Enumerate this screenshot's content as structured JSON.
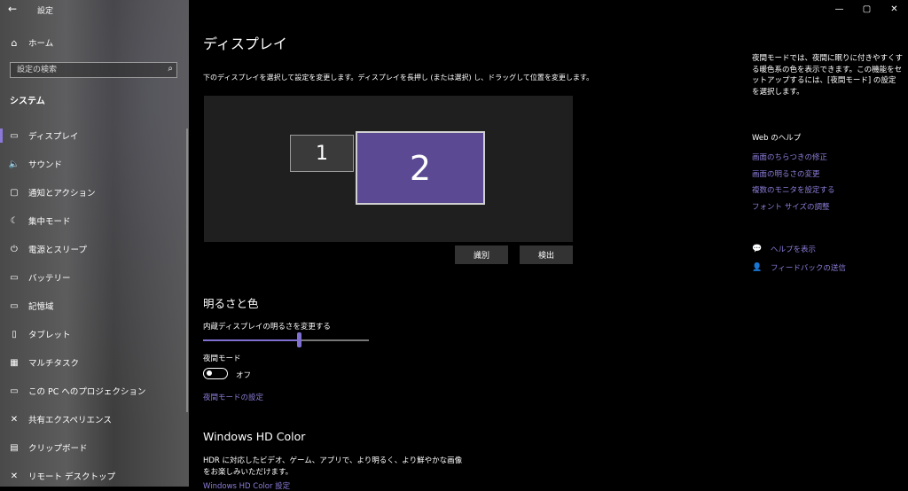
{
  "window": {
    "title": "設定",
    "back_icon": "←",
    "minimize": "—",
    "maximize": "▢",
    "close": "✕"
  },
  "sidebar": {
    "home_icon": "⌂",
    "home_label": "ホーム",
    "search_placeholder": "設定の検索",
    "search_icon": "⌕",
    "section_title": "システム",
    "items": [
      {
        "icon": "▭",
        "label": "ディスプレイ"
      },
      {
        "icon": "🔈",
        "label": "サウンド"
      },
      {
        "icon": "▢",
        "label": "通知とアクション"
      },
      {
        "icon": "☾",
        "label": "集中モード"
      },
      {
        "icon": "⏻",
        "label": "電源とスリープ"
      },
      {
        "icon": "▭",
        "label": "バッテリー"
      },
      {
        "icon": "▭",
        "label": "記憶域"
      },
      {
        "icon": "▯",
        "label": "タブレット"
      },
      {
        "icon": "▦",
        "label": "マルチタスク"
      },
      {
        "icon": "▭",
        "label": "この PC へのプロジェクション"
      },
      {
        "icon": "✕",
        "label": "共有エクスペリエンス"
      },
      {
        "icon": "▤",
        "label": "クリップボード"
      },
      {
        "icon": "✕",
        "label": "リモート デスクトップ"
      }
    ]
  },
  "main": {
    "title": "ディスプレイ",
    "description": "下のディスプレイを選択して設定を変更します。ディスプレイを長押し (または選択) し、ドラッグして位置を変更します。",
    "monitor_1": "1",
    "monitor_2": "2",
    "identify_button": "識別",
    "detect_button": "検出",
    "brightness_heading": "明るさと色",
    "brightness_label": "内蔵ディスプレイの明るさを変更する",
    "brightness_value": 58,
    "night_mode_label": "夜間モード",
    "night_mode_state": "オフ",
    "night_mode_link": "夜間モードの設定",
    "hdr_title": "Windows HD Color",
    "hdr_desc": "HDR に対応したビデオ、ゲーム、アプリで、より明るく、より鮮やかな画像をお楽しみいただけます。",
    "hdr_link": "Windows HD Color 設定"
  },
  "right": {
    "tip": "夜間モードでは、夜間に眠りに付きやすくする暖色系の色を表示できます。この機能をセットアップするには、[夜間モード] の設定を選択します。",
    "web_help_title": "Web のヘルプ",
    "links": [
      "画面のちらつきの修正",
      "画面の明るさの変更",
      "複数のモニタを設定する",
      "フォント サイズの調整"
    ],
    "help_icon": "💬",
    "help_label": "ヘルプを表示",
    "feedback_icon": "👤",
    "feedback_label": "フィードバックの送信"
  }
}
